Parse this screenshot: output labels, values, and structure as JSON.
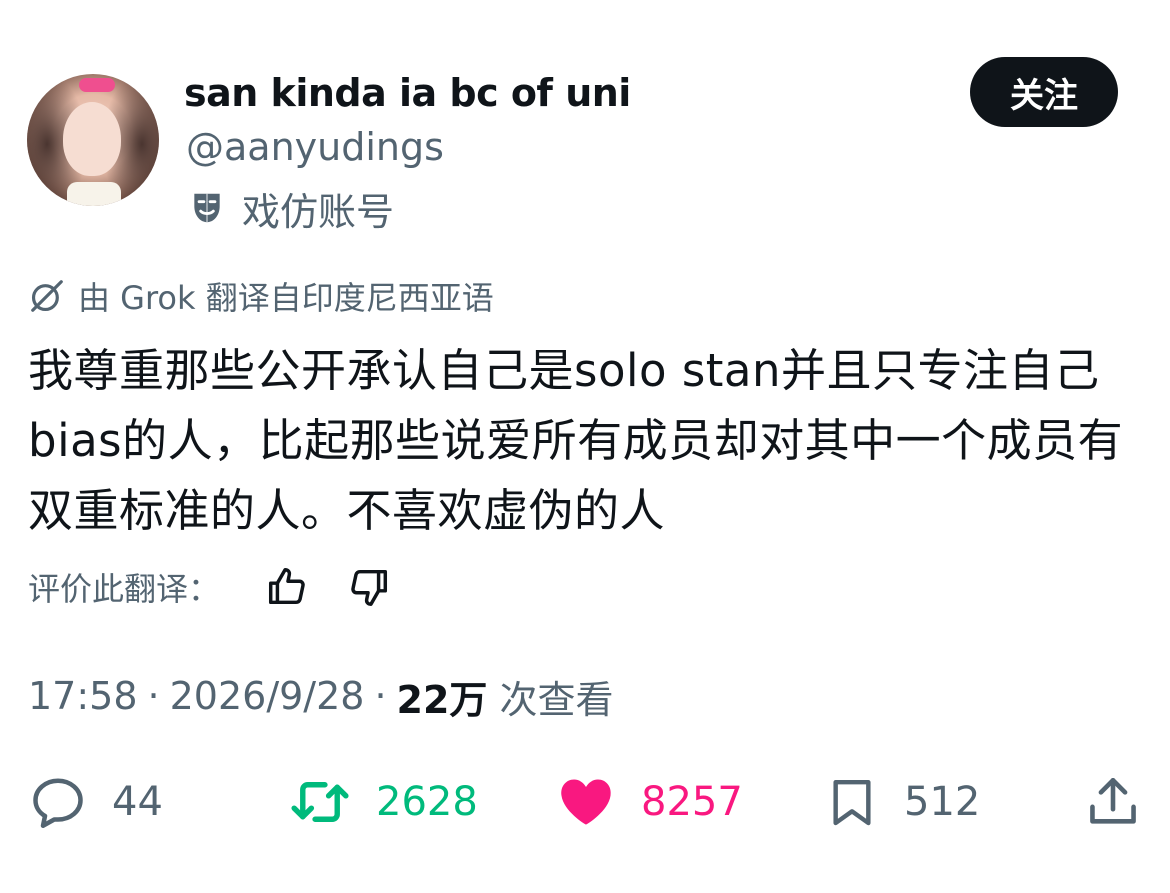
{
  "author": {
    "display_name": "san kinda ia bc of uni",
    "handle": "@aanyudings",
    "parody_label": "戏仿账号",
    "parody_icon": "parody-mask-icon"
  },
  "follow_button": {
    "label": "关注"
  },
  "translation": {
    "header": "由 Grok 翻译自印度尼西亚语",
    "icon": "grok-icon"
  },
  "tweet": {
    "text": "我尊重那些公开承认自己是solo stan并且只专注自己bias的人，比起那些说爱所有成员却对其中一个成员有双重标准的人。不喜欢虚伪的人"
  },
  "rate_translation": {
    "label": "评价此翻译：",
    "up_icon": "thumbs-up-icon",
    "down_icon": "thumbs-down-icon"
  },
  "meta": {
    "time": "17:58",
    "date": "2026/9/28",
    "separator": "·",
    "views_count": "22万",
    "views_label": "次查看"
  },
  "actions": {
    "replies": "44",
    "retweets": "2628",
    "likes": "8257",
    "bookmarks": "512"
  },
  "colors": {
    "text_primary": "#0f1419",
    "text_secondary": "#536471",
    "retweet_green": "#00ba7c",
    "like_pink": "#f91880",
    "follow_bg": "#0f1419"
  }
}
